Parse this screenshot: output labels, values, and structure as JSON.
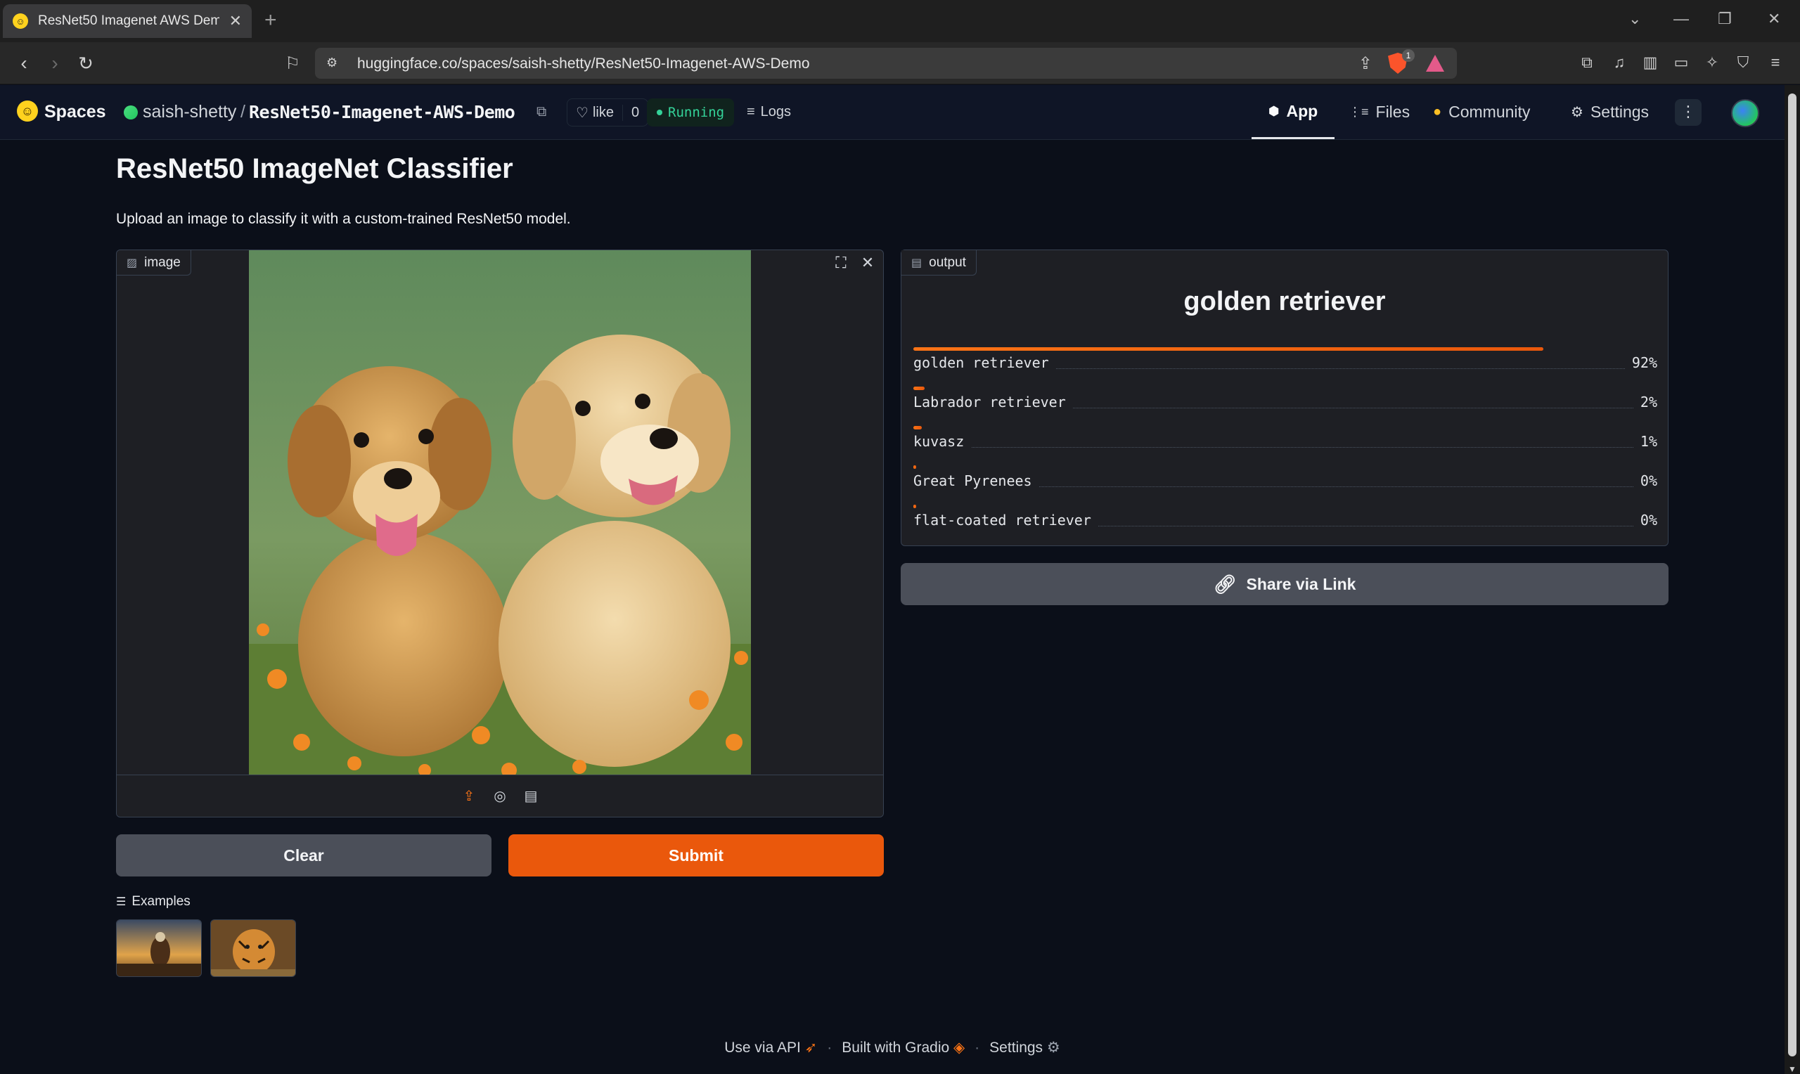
{
  "browser": {
    "tab_title": "ResNet50 Imagenet AWS Demo",
    "url": "huggingface.co/spaces/saish-shetty/ResNet50-Imagenet-AWS-Demo",
    "brave_badge": "1"
  },
  "header": {
    "spaces_label": "Spaces",
    "owner": "saish-shetty",
    "separator": "/",
    "repo": "ResNet50-Imagenet-AWS-Demo",
    "like_label": "like",
    "like_count": "0",
    "status": "Running",
    "logs_label": "Logs",
    "tabs": [
      {
        "label": "App",
        "icon": "cube-icon",
        "active": true
      },
      {
        "label": "Files",
        "icon": "files-icon",
        "active": false
      },
      {
        "label": "Community",
        "icon": "community-icon",
        "active": false
      },
      {
        "label": "Settings",
        "icon": "gear-icon",
        "active": false
      }
    ]
  },
  "app": {
    "title": "ResNet50 ImageNet Classifier",
    "description": "Upload an image to classify it with a custom-trained ResNet50 model.",
    "image_label": "image",
    "output_label": "output",
    "clear_label": "Clear",
    "submit_label": "Submit",
    "examples_label": "Examples",
    "share_label": "Share via Link"
  },
  "output": {
    "top_label": "golden retriever",
    "confidences": [
      {
        "label": "golden retriever",
        "value": "92%",
        "fraction": 0.92
      },
      {
        "label": "Labrador retriever",
        "value": "2%",
        "fraction": 0.016
      },
      {
        "label": "kuvasz",
        "value": "1%",
        "fraction": 0.012
      },
      {
        "label": "Great Pyrenees",
        "value": "0%",
        "fraction": 0.004
      },
      {
        "label": "flat-coated retriever",
        "value": "0%",
        "fraction": 0.003
      }
    ]
  },
  "footer": {
    "api_label": "Use via API",
    "built_label": "Built with Gradio",
    "settings_label": "Settings",
    "separator": "·"
  },
  "colors": {
    "accent": "#ea580c",
    "background": "#0b0f19",
    "panel": "#1e1f24",
    "running": "#34d399"
  }
}
